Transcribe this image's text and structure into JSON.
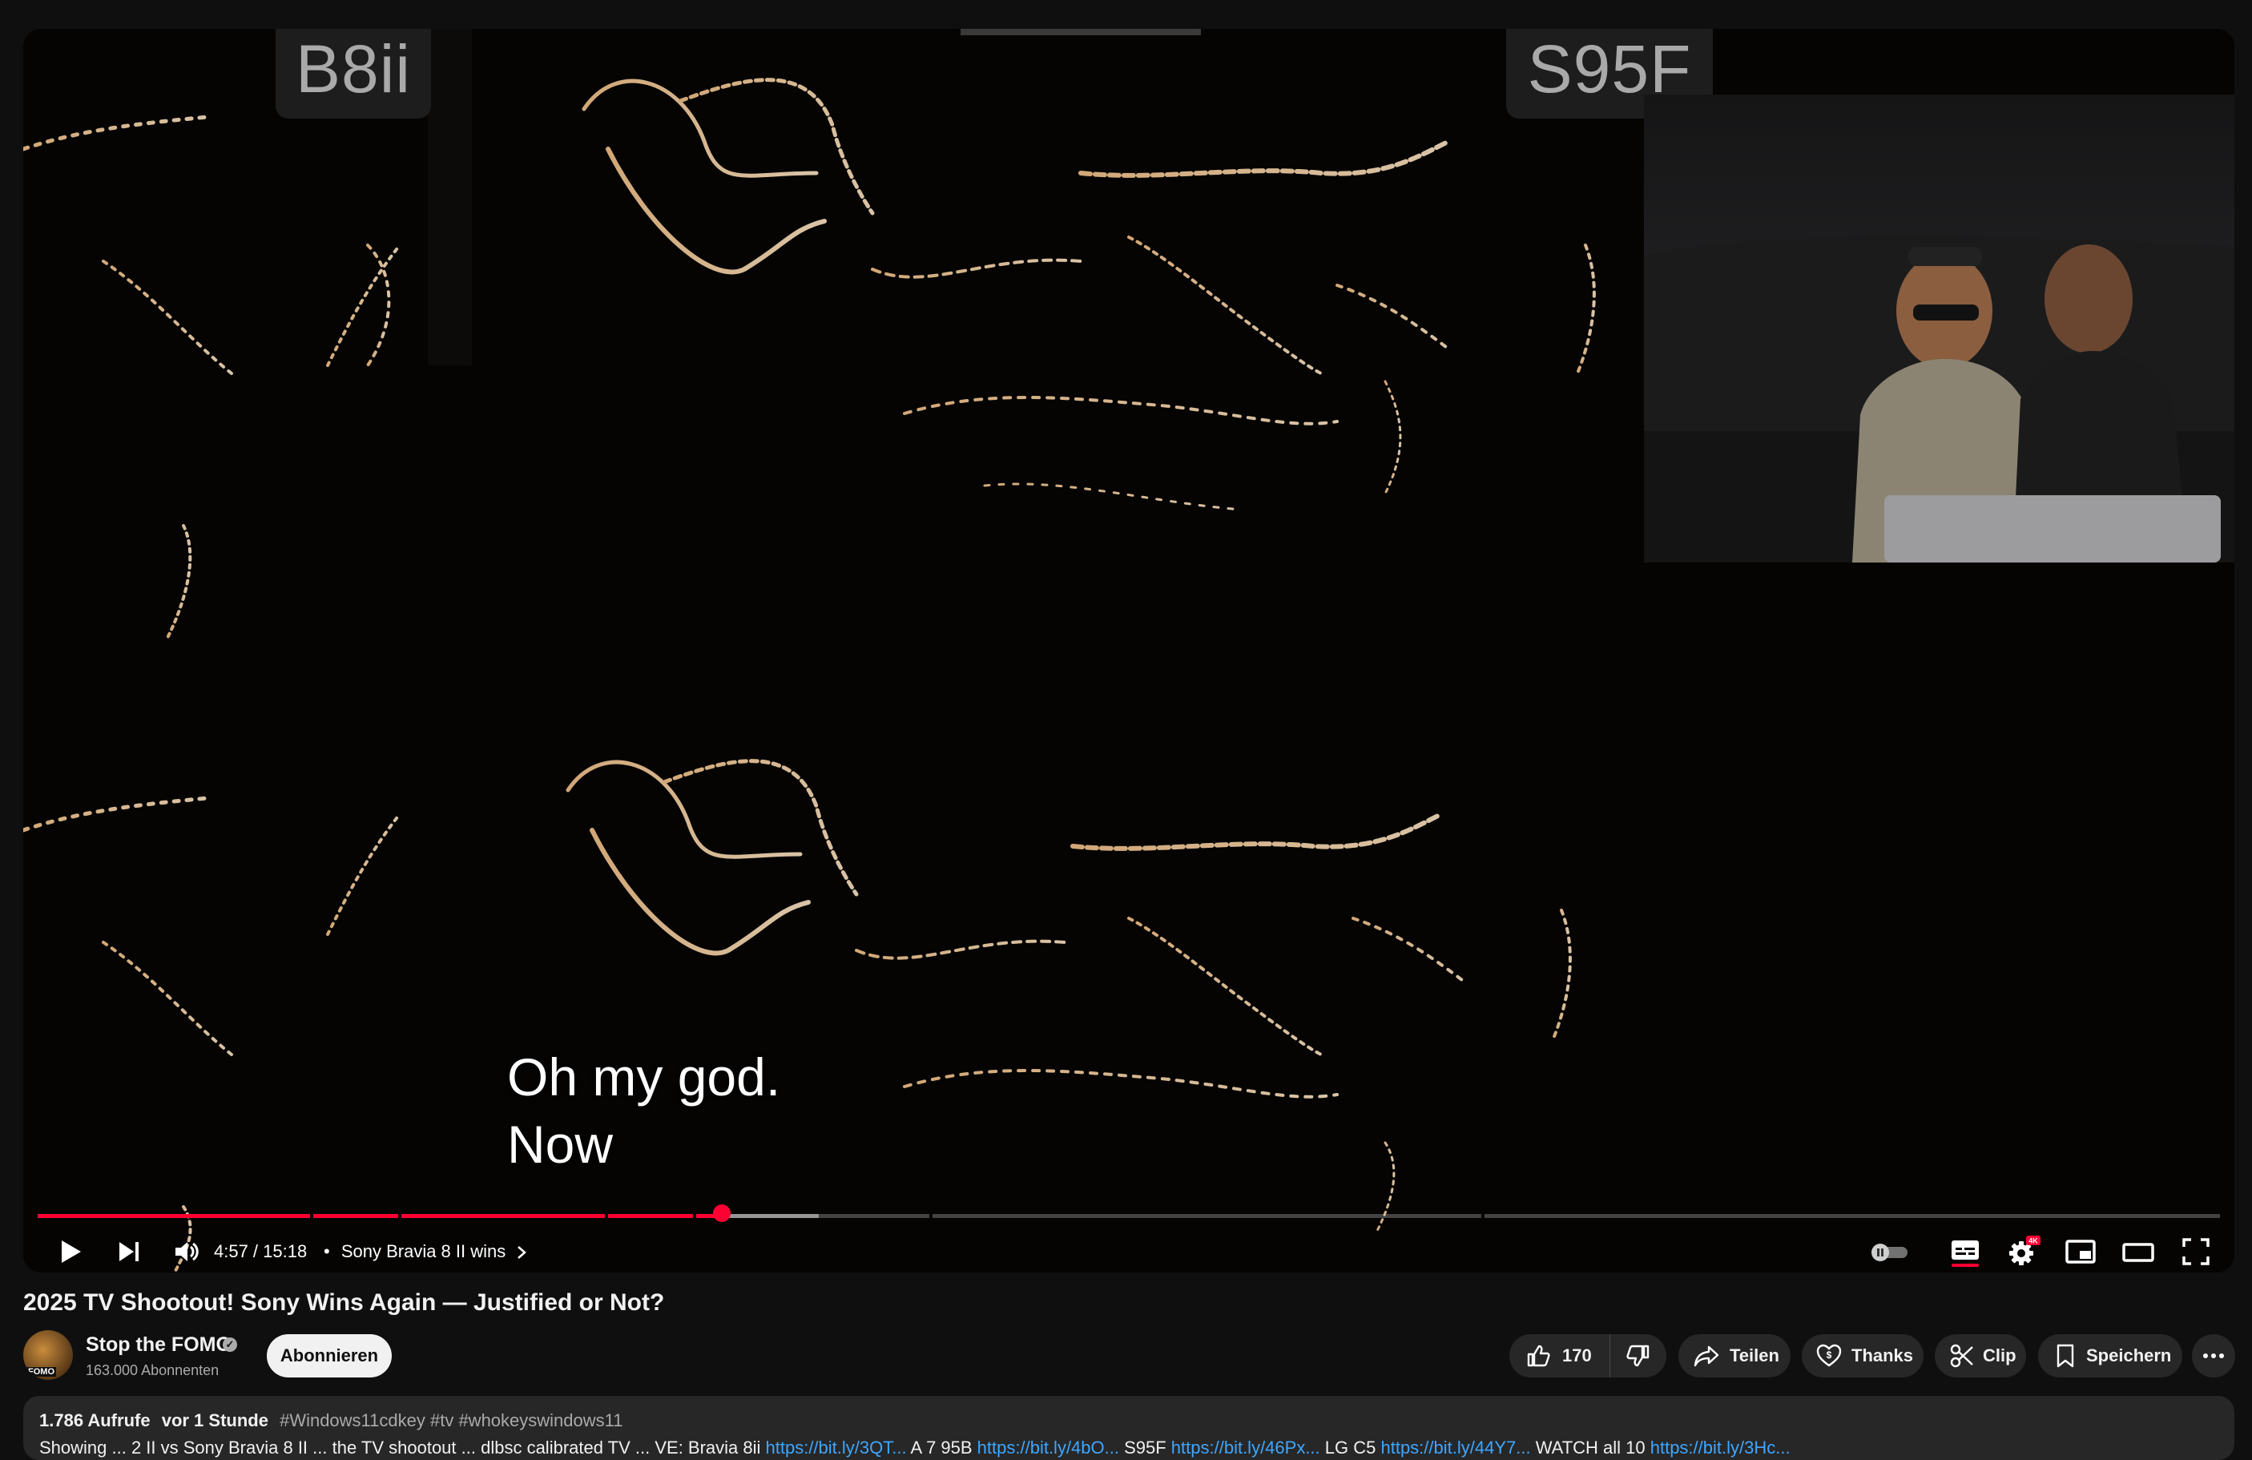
{
  "video": {
    "tv_label_left": "B8ii",
    "tv_label_right": "S95F",
    "captions": [
      "Oh my god.",
      "Now"
    ]
  },
  "player": {
    "progress_fraction": 0.3136,
    "buffer_fraction": 0.358,
    "time": "4:57 / 15:18",
    "chapter_separator": "•",
    "chapter_title": "Sony Bravia 8 II wins",
    "quality_badge": "4K",
    "colors": {
      "played": "#ff0033",
      "subtitle_underline": "#ff0033"
    }
  },
  "title": "2025 TV Shootout! Sony Wins Again — Justified or Not?",
  "channel": {
    "name": "Stop the FOMO",
    "subscribers": "163.000 Abonnenten",
    "avatar_text": "FOMO",
    "subscribe_label": "Abonnieren"
  },
  "actions": {
    "like_count": "170",
    "share_label": "Teilen",
    "thanks_label": "Thanks",
    "clip_label": "Clip",
    "save_label": "Speichern"
  },
  "description": {
    "views": "1.786 Aufrufe",
    "age": "vor 1 Stunde",
    "hashtags": "#Windows11cdkey #tv #whokeyswindows11",
    "line2_parts": [
      "Showing ... 2 II vs Sony Bravia 8 II ... the TV shootout ... dlbsc calibrated TV ... VE: Bravia 8ii ",
      "https://bit.ly/3QT...",
      " A 7 95B ",
      "https://bit.ly/4bO...",
      " S95F ",
      "https://bit.ly/46Px...",
      " LG C5 ",
      "https://bit.ly/44Y7...",
      " WATCH all 10 ",
      "https://bit.ly/3Hc..."
    ]
  }
}
